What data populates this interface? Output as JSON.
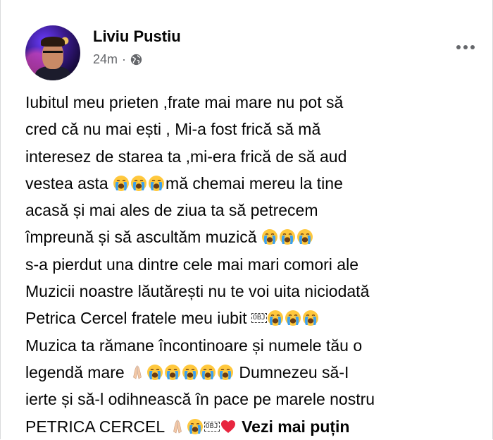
{
  "post": {
    "author": "Liviu Pustiu",
    "time": "24m",
    "separator": "·",
    "privacy_icon": "globe-icon",
    "menu_icon": "more-options-icon"
  },
  "text_lines": [
    "Iubitul meu prieten ,frate mai mare nu pot să",
    "cred că nu mai ești , Mi-a fost frică să mă",
    "interesez de starea ta ,mi-era frică de să aud",
    "vestea asta ",
    "mă chemai mereu la tine",
    "acasă și mai ales de ziua ta să petrecem",
    "împreună și să ascultăm muzică ",
    "s-a pierdut una dintre cele mai mari comori ale",
    "Muzicii noastre lăutărești nu te voi uita niciodată",
    "Petrica Cercel fratele meu iubit ",
    "Muzica ta rămane încontinoare și numele tău o",
    "legendă mare ",
    " Dumnezeu să-I",
    "ierte și să-l odihnească în pace pe marele nostru",
    "PETRICA CERCEL ",
    "Vezi mai puțin"
  ],
  "obj_glyph": "OBJ",
  "emoji": {
    "crying": "loudly-crying-face-emoji",
    "praying": "folded-hands-emoji",
    "heart": "red-heart-emoji"
  },
  "colors": {
    "text": "#050505",
    "secondary": "#65676b",
    "emoji_face": "#ffc83d",
    "tears": "#3aa0f0",
    "heart": "#e8263f"
  }
}
